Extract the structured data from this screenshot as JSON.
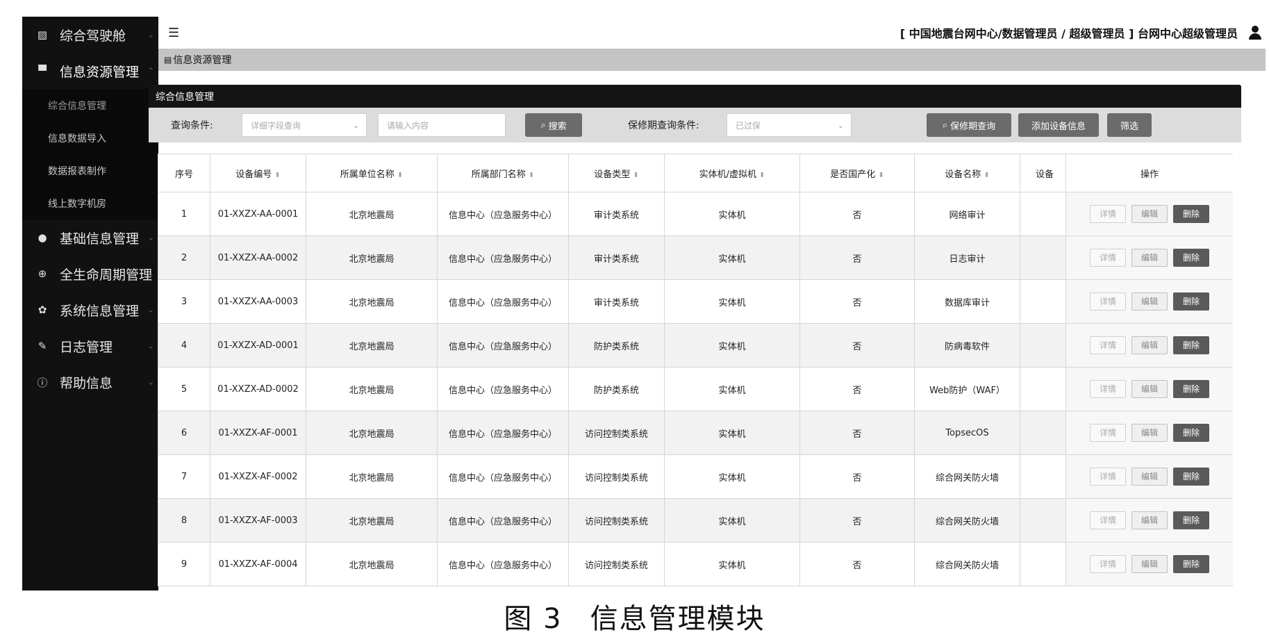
{
  "sidebar": {
    "items": [
      {
        "label": "综合驾驶舱",
        "icon": "chart-icon"
      },
      {
        "label": "信息资源管理",
        "icon": "monitor-icon"
      },
      {
        "label": "基础信息管理",
        "icon": "user-icon"
      },
      {
        "label": "全生命周期管理",
        "icon": "plus-circle-icon"
      },
      {
        "label": "系统信息管理",
        "icon": "gear-icon"
      },
      {
        "label": "日志管理",
        "icon": "pencil-icon"
      },
      {
        "label": "帮助信息",
        "icon": "info-icon"
      }
    ],
    "submenu": [
      {
        "label": "综合信息管理"
      },
      {
        "label": "信息数据导入"
      },
      {
        "label": "数据报表制作"
      },
      {
        "label": "线上数字机房"
      }
    ]
  },
  "header": {
    "user_info": "[ 中国地震台网中心/数据管理员 / 超级管理员 ] 台网中心超级管理员"
  },
  "breadcrumb": {
    "label": "信息资源管理"
  },
  "panel": {
    "title": "综合信息管理"
  },
  "query": {
    "label": "查询条件:",
    "field_select": "详细字段查询",
    "input_placeholder": "请输入内容",
    "search_button": "搜索",
    "warranty_label": "保修期查询条件:",
    "warranty_select": "已过保",
    "warranty_button": "保修期查询",
    "add_button": "添加设备信息",
    "filter_button": "筛选"
  },
  "table": {
    "columns": [
      "序号",
      "设备编号",
      "所属单位名称",
      "所属部门名称",
      "设备类型",
      "实体机/虚拟机",
      "是否国产化",
      "设备名称",
      "设备",
      "操作"
    ],
    "actions": {
      "detail": "详情",
      "edit": "编辑",
      "delete": "删除"
    },
    "rows": [
      [
        "1",
        "01-XXZX-AA-0001",
        "北京地震局",
        "信息中心（应急服务中心）",
        "审计类系统",
        "实体机",
        "否",
        "网络审计"
      ],
      [
        "2",
        "01-XXZX-AA-0002",
        "北京地震局",
        "信息中心（应急服务中心）",
        "审计类系统",
        "实体机",
        "否",
        "日志审计"
      ],
      [
        "3",
        "01-XXZX-AA-0003",
        "北京地震局",
        "信息中心（应急服务中心）",
        "审计类系统",
        "实体机",
        "否",
        "数据库审计"
      ],
      [
        "4",
        "01-XXZX-AD-0001",
        "北京地震局",
        "信息中心（应急服务中心）",
        "防护类系统",
        "实体机",
        "否",
        "防病毒软件"
      ],
      [
        "5",
        "01-XXZX-AD-0002",
        "北京地震局",
        "信息中心（应急服务中心）",
        "防护类系统",
        "实体机",
        "否",
        "Web防护（WAF）"
      ],
      [
        "6",
        "01-XXZX-AF-0001",
        "北京地震局",
        "信息中心（应急服务中心）",
        "访问控制类系统",
        "实体机",
        "否",
        "TopsecOS"
      ],
      [
        "7",
        "01-XXZX-AF-0002",
        "北京地震局",
        "信息中心（应急服务中心）",
        "访问控制类系统",
        "实体机",
        "否",
        "综合网关防火墙"
      ],
      [
        "8",
        "01-XXZX-AF-0003",
        "北京地震局",
        "信息中心（应急服务中心）",
        "访问控制类系统",
        "实体机",
        "否",
        "综合网关防火墙"
      ],
      [
        "9",
        "01-XXZX-AF-0004",
        "北京地震局",
        "信息中心（应急服务中心）",
        "访问控制类系统",
        "实体机",
        "否",
        "综合网关防火墙"
      ]
    ]
  },
  "caption": {
    "figure": "图 3",
    "title": "信息管理模块"
  }
}
